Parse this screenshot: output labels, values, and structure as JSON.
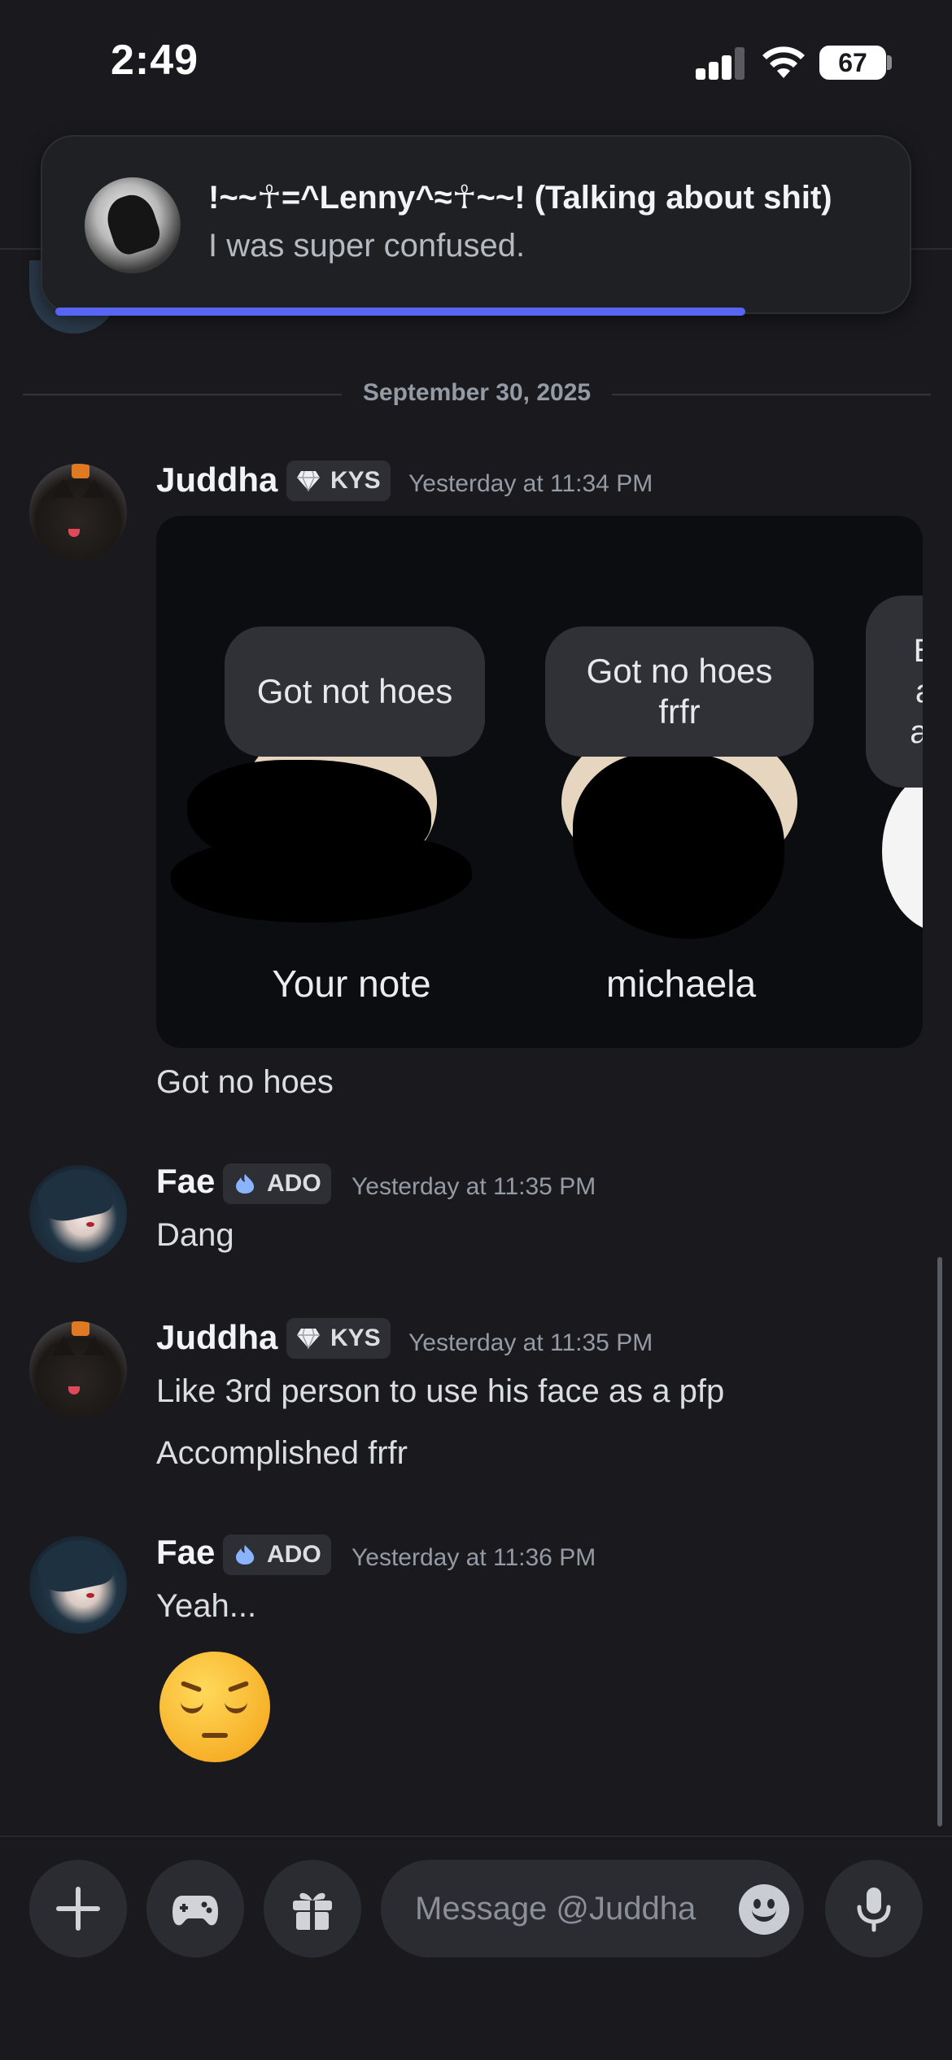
{
  "status_bar": {
    "time": "2:49",
    "battery": "67"
  },
  "notification": {
    "title": "!~~☥=^Lenny^≈☥~~! (Talking about shit)",
    "body": "I was super confused."
  },
  "divider": {
    "date": "September 30, 2025"
  },
  "messages": [
    {
      "author": "Juddha",
      "badge": "KYS",
      "timestamp": "Yesterday at 11:34 PM",
      "attachment": {
        "notes": [
          {
            "bubble": "Got not hoes",
            "name": "Your note"
          },
          {
            "bubble": "Got no hoes frfr",
            "name": "michaela"
          },
          {
            "bubble": "B a ar",
            "name": ""
          }
        ]
      },
      "lines": [
        "Got no hoes"
      ]
    },
    {
      "author": "Fae",
      "badge": "ADO",
      "timestamp": "Yesterday at 11:35 PM",
      "lines": [
        "Dang"
      ]
    },
    {
      "author": "Juddha",
      "badge": "KYS",
      "timestamp": "Yesterday at 11:35 PM",
      "lines": [
        "Like 3rd person to use his face as a pfp",
        "Accomplished frfr"
      ]
    },
    {
      "author": "Fae",
      "badge": "ADO",
      "timestamp": "Yesterday at 11:36 PM",
      "lines": [
        "Yeah..."
      ],
      "emoji": "pensive-face"
    }
  ],
  "composer": {
    "placeholder": "Message @Juddha",
    "buttons": [
      "plus-icon",
      "gamepad-icon",
      "gift-icon",
      "microphone-icon"
    ]
  },
  "colors": {
    "background": "#1a1a1e",
    "accent": "#5865f2",
    "badge_bg": "#2e2f35",
    "muted_text": "#949ba4"
  }
}
